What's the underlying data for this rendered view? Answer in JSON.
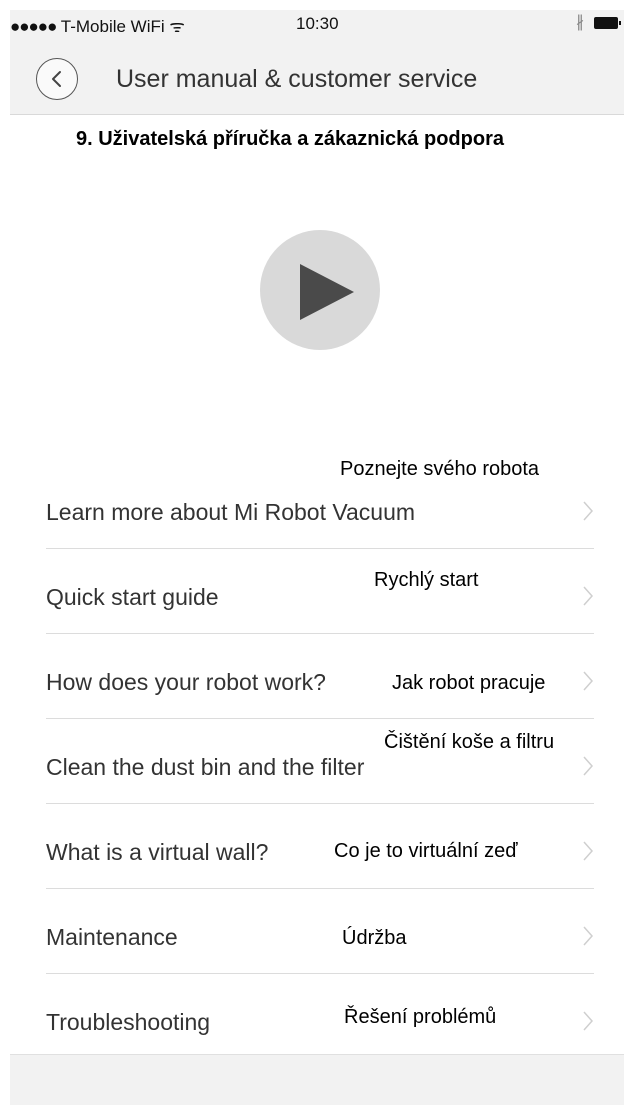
{
  "status_bar": {
    "carrier": "T-Mobile WiFi",
    "signal_dots": "●●●●●",
    "wifi_glyph": "ᯤ",
    "time": "10:30",
    "bluetooth_glyph": "∦"
  },
  "header": {
    "title": "User manual & customer service",
    "back_icon": "chevron-left-icon"
  },
  "overlay_heading": "9. Uživatelská příručka a zákaznická podpora",
  "video": {
    "icon": "play-icon"
  },
  "menu": [
    {
      "label": "Learn more about Mi Robot Vacuum",
      "translation": "Poznejte svého robota"
    },
    {
      "label": "Quick start guide",
      "translation": "Rychlý start"
    },
    {
      "label": "How does your robot work?",
      "translation": "Jak robot pracuje"
    },
    {
      "label": "Clean the dust bin and the filter",
      "translation": "Čištění koše a filtru"
    },
    {
      "label": "What is a virtual wall?",
      "translation": "Co je to virtuální zeď"
    },
    {
      "label": "Maintenance",
      "translation": "Údržba"
    },
    {
      "label": "Troubleshooting",
      "translation": "Řešení problémů"
    }
  ],
  "colors": {
    "header_bg": "#f2f2f2",
    "divider": "#dcdcdc",
    "play_circle": "#d9d9d9",
    "play_triangle": "#4a4a4a"
  }
}
